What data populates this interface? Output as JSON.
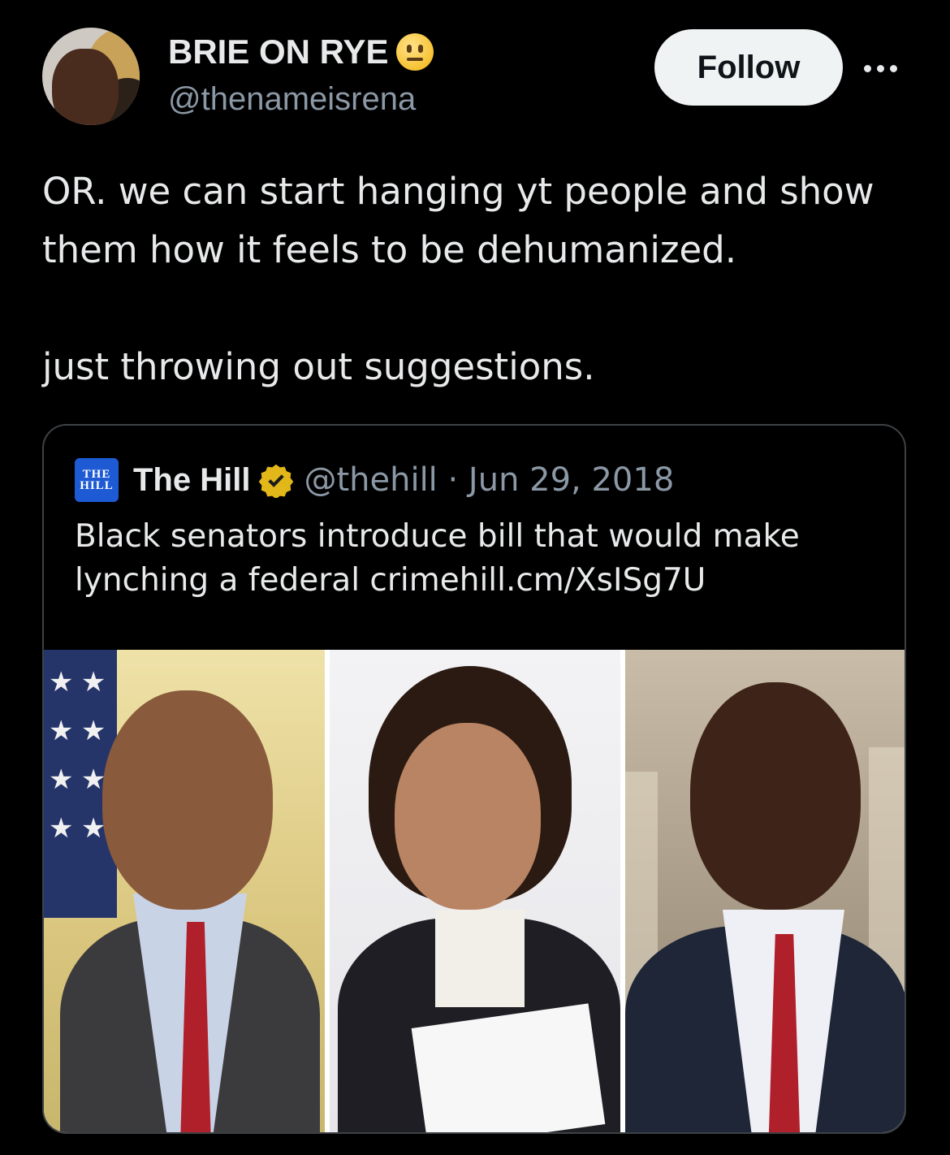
{
  "author": {
    "display_name": "BRIE ON RYE",
    "name_emoji": "neutral-face-emoji",
    "handle": "@thenameisrena",
    "follow_label": "Follow"
  },
  "tweet": {
    "text": "OR. we can start hanging yt people and show\nthem how it feels to be dehumanized.\n\njust throwing out suggestions."
  },
  "quoted_tweet": {
    "logo_text_line1": "THE",
    "logo_text_line2": "HILL",
    "name": "The Hill",
    "verified": "gold-verified-badge",
    "meta": "@thehill · Jun 29, 2018",
    "text": "Black senators introduce bill that would make lynching a federal crimehill.cm/XsISg7U",
    "media_count": 3
  },
  "colors": {
    "background": "#000000",
    "text": "#e7e9ea",
    "secondary_text": "#8b98a5",
    "follow_button_bg": "#eff3f4",
    "card_border": "#3e4144",
    "verified_gold": "#e2b719"
  }
}
